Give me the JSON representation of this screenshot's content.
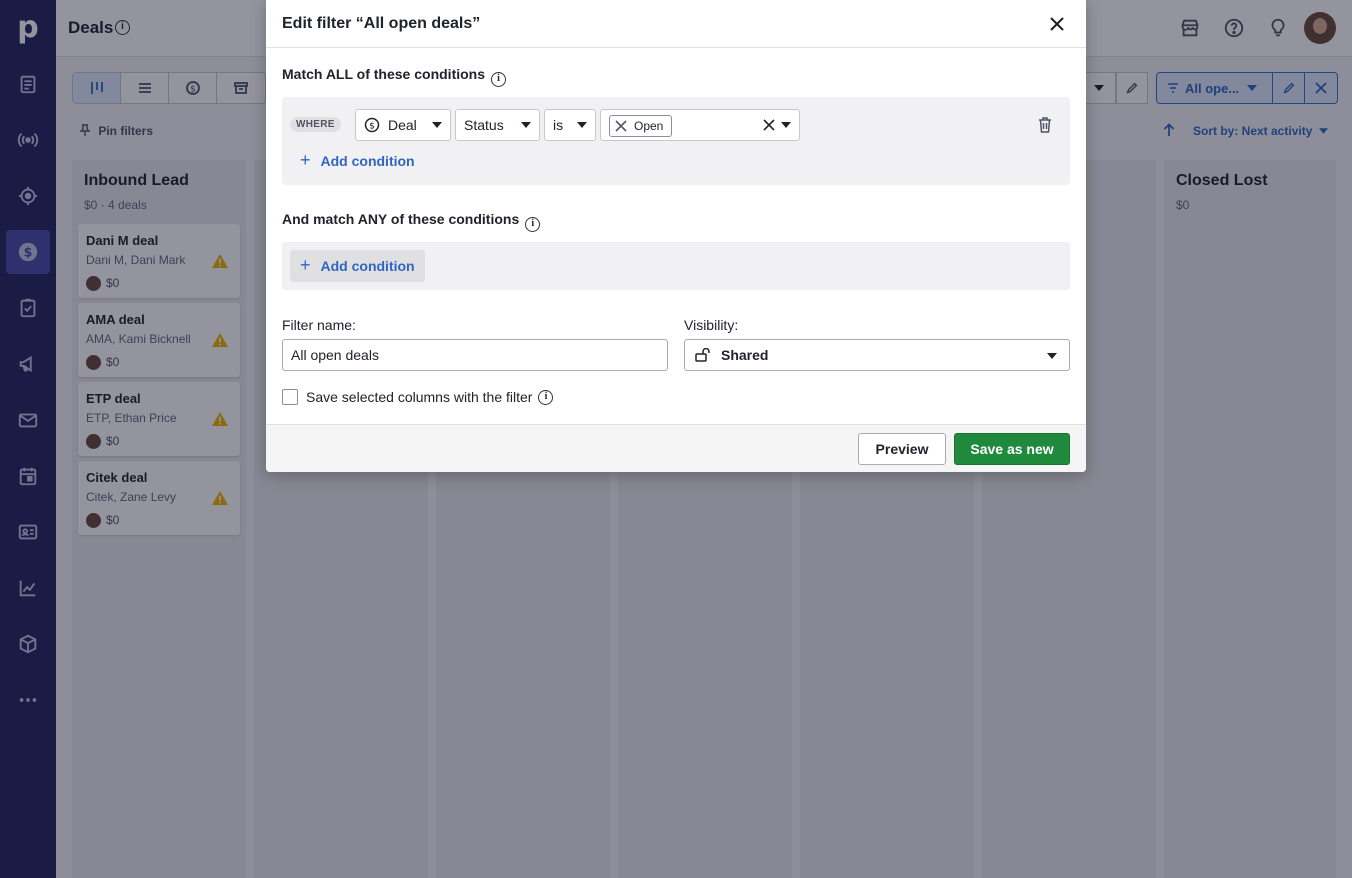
{
  "app": {
    "logo_letter": "p",
    "page_title": "Deals"
  },
  "sidebar": {
    "items": [
      {
        "name": "leads-icon",
        "active": false
      },
      {
        "name": "broadcast-icon",
        "active": false
      },
      {
        "name": "target-icon",
        "active": false
      },
      {
        "name": "deals-icon",
        "active": true
      },
      {
        "name": "tasks-icon",
        "active": false
      },
      {
        "name": "campaigns-icon",
        "active": false
      },
      {
        "name": "mail-icon",
        "active": false
      },
      {
        "name": "calendar-icon",
        "active": false
      },
      {
        "name": "contacts-icon",
        "active": false
      },
      {
        "name": "insights-icon",
        "active": false
      },
      {
        "name": "products-icon",
        "active": false
      },
      {
        "name": "more-icon",
        "active": false
      }
    ]
  },
  "toolbar": {
    "pin_filters": "Pin filters",
    "filter_label": "All ope...",
    "sort_label": "Sort by: Next activity"
  },
  "pipeline": {
    "stages": [
      {
        "title": "Inbound Lead",
        "subtitle": "$0 · 4 deals",
        "deals": [
          {
            "title": "Dani M deal",
            "person": "Dani M, Dani Mark",
            "value": "$0"
          },
          {
            "title": "AMA deal",
            "person": "AMA, Kami Bicknell",
            "value": "$0"
          },
          {
            "title": "ETP deal",
            "person": "ETP, Ethan Price",
            "value": "$0"
          },
          {
            "title": "Citek deal",
            "person": "Citek, Zane Levy",
            "value": "$0"
          }
        ]
      },
      {
        "title": "Closed Lost",
        "subtitle": "$0",
        "deals": []
      }
    ]
  },
  "modal": {
    "title": "Edit filter “All open deals”",
    "all_section_label": "Match ALL of these conditions",
    "any_section_label": "And match ANY of these conditions",
    "info_glyph": "i",
    "where_label": "WHERE",
    "condition": {
      "entity": "Deal",
      "field": "Status",
      "operator": "is",
      "value_chip": "Open"
    },
    "add_condition_label": "Add condition",
    "plus_glyph": "+",
    "filter_name_label": "Filter name:",
    "filter_name_value": "All open deals",
    "visibility_label": "Visibility:",
    "visibility_value": "Shared",
    "save_columns_label": "Save selected columns with the filter",
    "preview_button": "Preview",
    "save_button": "Save as new"
  },
  "colors": {
    "sidebar_bg": "#26265e",
    "accent_blue": "#2f66c3",
    "save_green": "#1f8a3b",
    "warning_yellow": "#f0b400"
  }
}
